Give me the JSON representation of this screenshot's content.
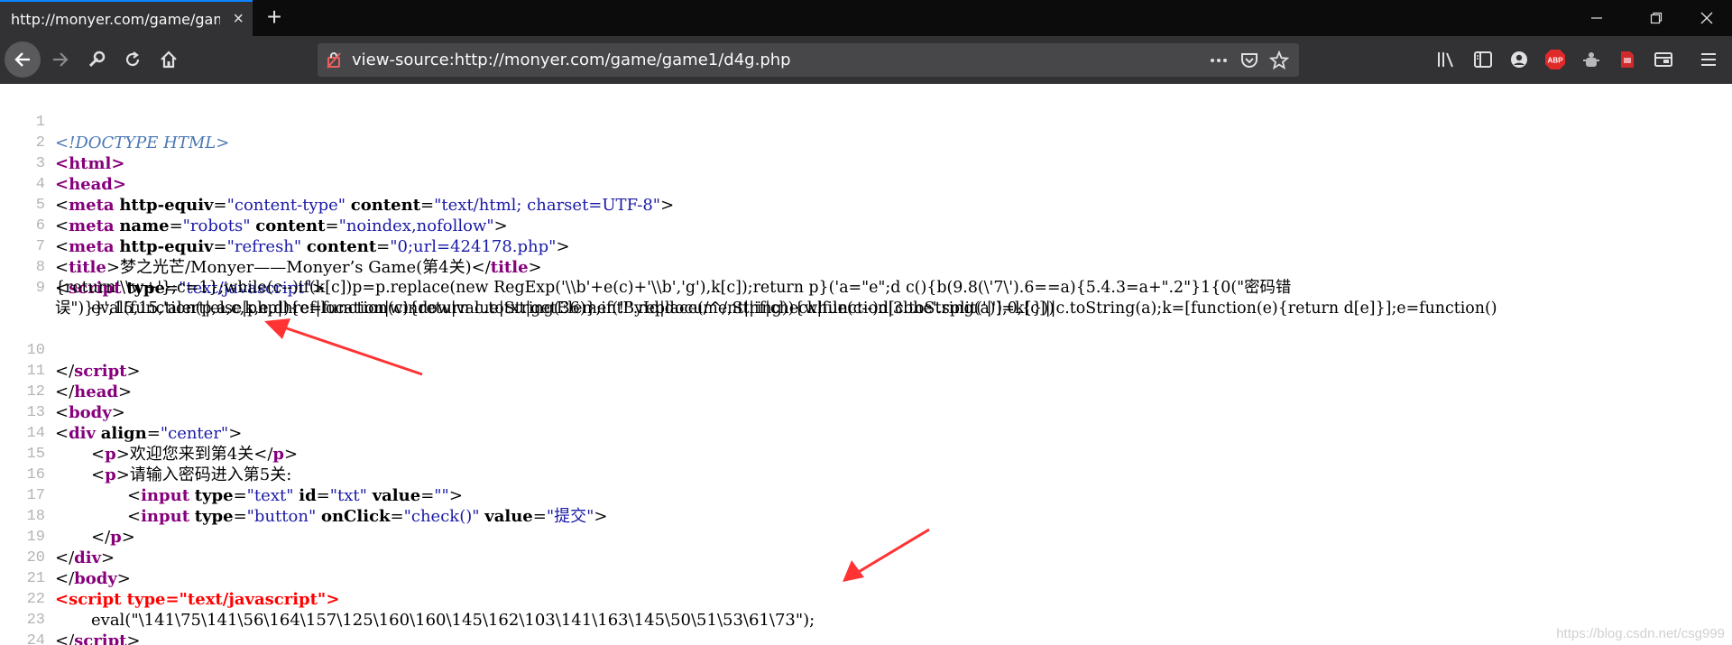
{
  "window": {
    "tab_title": "http://monyer.com/game/game1",
    "tab_close": "×",
    "new_tab": "+",
    "controls": {
      "minimize": "minimize",
      "restore": "restore",
      "close": "close"
    }
  },
  "nav": {
    "url": "view-source:http://monyer.com/game/game1/d4g.php",
    "icons": [
      "back-icon",
      "forward-icon",
      "wrench-icon",
      "reload-icon",
      "home-icon",
      "shield-slash-icon",
      "more-icon",
      "pocket-icon",
      "star-icon",
      "library-icon",
      "sidebar-icon",
      "account-icon",
      "adblock-icon",
      "extension-icon",
      "pdf-icon",
      "reader-icon",
      "menu-icon"
    ],
    "abp_label": "ABP"
  },
  "source": {
    "lines": [
      {
        "n": "1",
        "t": "<!DOCTYPE HTML>"
      },
      {
        "n": "2",
        "t": "<html>"
      },
      {
        "n": "3",
        "t": "<head>"
      },
      {
        "n": "4",
        "tag": "meta",
        "a1": "http-equiv",
        "v1": "\"content-type\"",
        "a2": "content",
        "v2": "\"text/html; charset=UTF-8\""
      },
      {
        "n": "5",
        "tag": "meta",
        "a1": "name",
        "v1": "\"robots\"",
        "a2": "content",
        "v2": "\"noindex,nofollow\""
      },
      {
        "n": "6",
        "tag": "meta",
        "a1": "http-equiv",
        "v1": "\"refresh\"",
        "a2": "content",
        "v2": "\"0;url=424178.php\""
      },
      {
        "n": "7",
        "open": "title",
        "text": "梦之光芒/Monyer——Monyer’s Game(第4关)",
        "close": "title"
      },
      {
        "n": "8",
        "tag": "script",
        "a1": "type",
        "v1": "\"text/javascript\""
      },
      {
        "n": "9",
        "text": "eval(function(p,a,c,k,e,d){e=function(c){return c.toString(36)};if(!''.replace(/^/,String)){while(c--)d[c.toString(a)]=k[c]||c.toString(a);k=[function(e){return d[e]}];e=function()"
      },
      {
        "n": "",
        "text": "{return'\\\\w+'};c=1};while(c--)if(k[c])p=p.replace(new RegExp('\\\\b'+e(c)+'\\\\b','g'),k[c]);return p}('a=\"e\";d c(){b(9.8(\\'7\\').6==a){5.4.3=a+\".2\"}1{0(\"密码错"
      },
      {
        "n": "",
        "text": "误\")}}',15,15,'alert|else|php|href|location|window|value|txt|getElementById|document||if|check|function|3bhe'.split('|'),0,{}))"
      },
      {
        "n": "10",
        "close": "script"
      },
      {
        "n": "11",
        "close": "head"
      },
      {
        "n": "12",
        "open": "body"
      },
      {
        "n": "13",
        "tag": "div",
        "a1": "align",
        "v1": "\"center\""
      },
      {
        "n": "14",
        "open": "p",
        "text": "欢迎您来到第4关",
        "close": "p"
      },
      {
        "n": "15",
        "open": "p",
        "text": "请输入密码进入第5关:"
      },
      {
        "n": "16",
        "tag": "input",
        "a1": "type",
        "v1": "\"text\"",
        "a2": "id",
        "v2": "\"txt\"",
        "a3": "value",
        "v3": "\"\""
      },
      {
        "n": "17",
        "tag": "input",
        "a1": "type",
        "v1": "\"button\"",
        "a2": "onClick",
        "v2": "\"check()\"",
        "a3": "value",
        "v3": "\"提交\""
      },
      {
        "n": "18",
        "close": "p"
      },
      {
        "n": "19",
        "close": "div"
      },
      {
        "n": "20",
        "close": "body"
      },
      {
        "n": "21",
        "red": "<script type=\"text/javascript\">"
      },
      {
        "n": "22",
        "text": "eval(\"\\141\\75\\141\\56\\164\\157\\125\\160\\160\\145\\162\\103\\141\\163\\145\\50\\51\\53\\61\\73\");"
      },
      {
        "n": "23",
        "close": "script"
      },
      {
        "n": "24",
        "close": "html"
      }
    ]
  },
  "annotations": {
    "arrows": 2,
    "color": "#ff3333"
  },
  "watermark": "https://blog.csdn.net/csg999"
}
